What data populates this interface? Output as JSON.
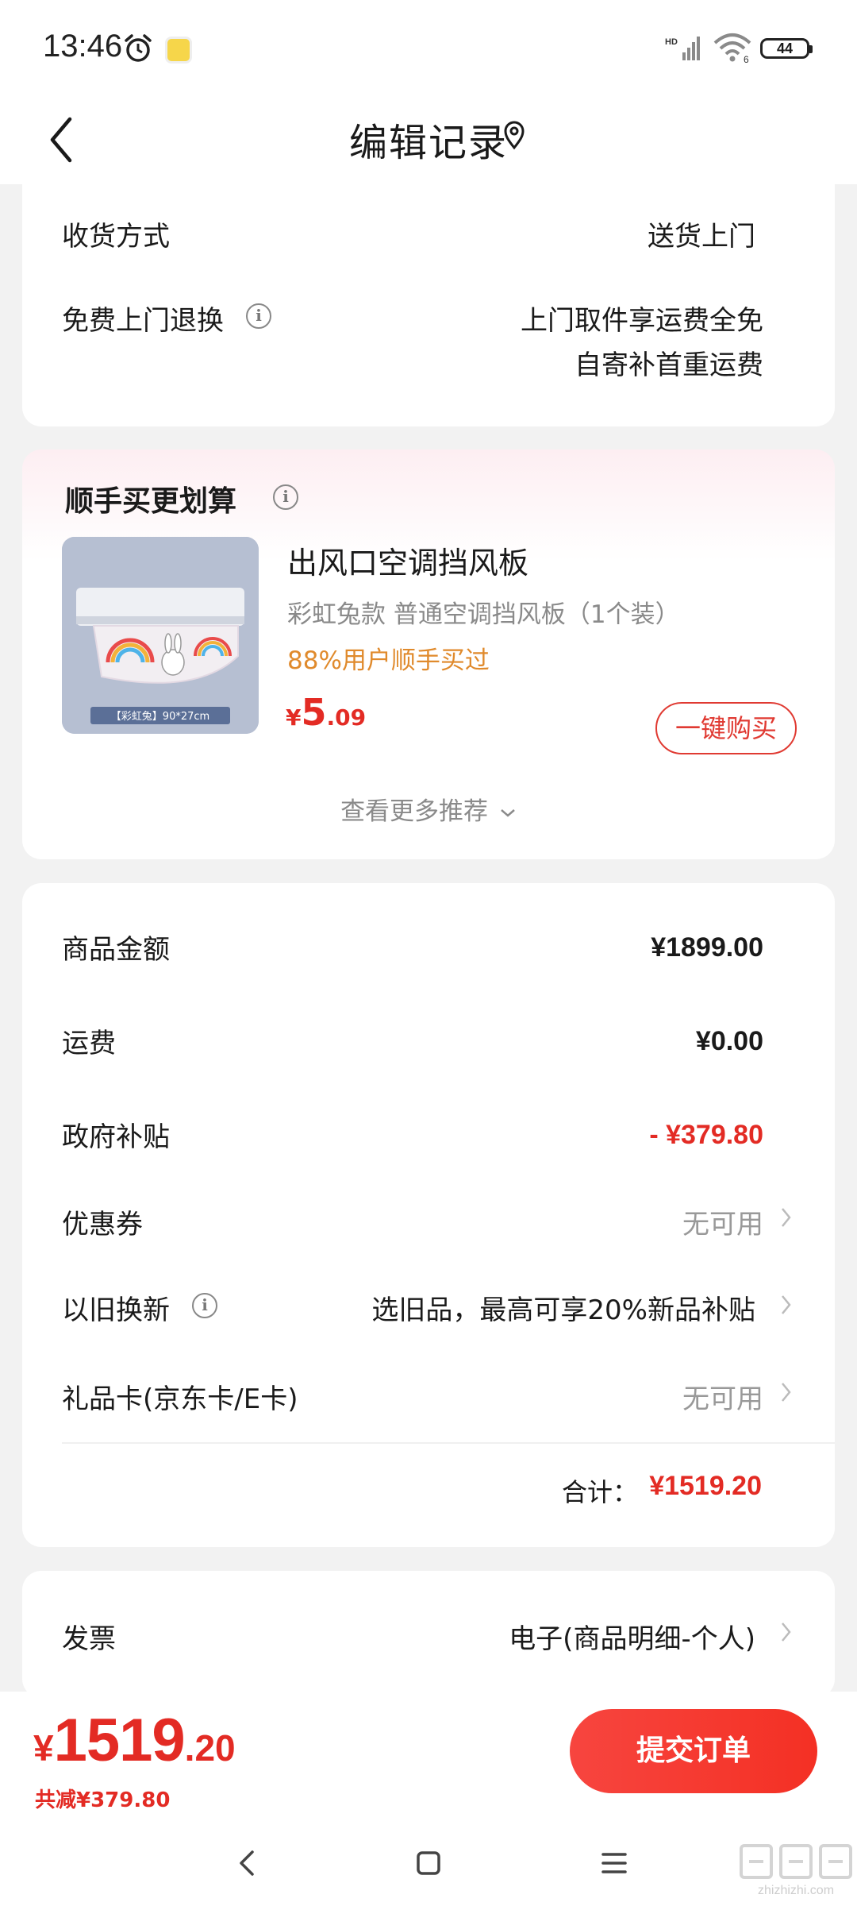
{
  "status_bar": {
    "time": "13:46",
    "network": "HD",
    "wifi_label": "6",
    "battery": "44"
  },
  "header": {
    "title": "编辑记录"
  },
  "delivery": {
    "method_label": "收货方式",
    "method_value": "送货上门",
    "return_label": "免费上门退换",
    "return_value_line1": "上门取件享运费全免",
    "return_value_line2": "自寄补首重运费"
  },
  "recommend": {
    "title": "顺手买更划算",
    "product_name": "出风口空调挡风板",
    "product_variant": "彩虹兔款   普通空调挡风板（1个装）",
    "product_stat": "88%用户顺手买过",
    "price_currency": "¥",
    "price_int": "5",
    "price_dec": ".09",
    "image_caption": "【彩虹兔】90*27cm",
    "buy_label": "一键购买",
    "more_label": "查看更多推荐"
  },
  "price_breakdown": {
    "goods_label": "商品金额",
    "goods_value": "¥1899.00",
    "shipping_label": "运费",
    "shipping_value": "¥0.00",
    "subsidy_label": "政府补贴",
    "subsidy_value": "- ¥379.80",
    "coupon_label": "优惠券",
    "coupon_value": "无可用",
    "tradein_label": "以旧换新",
    "tradein_value": "选旧品，最高可享20%新品补贴",
    "giftcard_label": "礼品卡(京东卡/E卡)",
    "giftcard_value": "无可用",
    "total_label": "合计：",
    "total_value": "¥1519.20"
  },
  "invoice": {
    "label": "发票",
    "value": "电子(商品明细-个人)"
  },
  "bottom_bar": {
    "currency": "¥",
    "total_int": "1519",
    "total_dec": ".20",
    "saved": "共减¥379.80",
    "submit_label": "提交订单"
  },
  "watermark": {
    "text": "zhizhizhi.com"
  },
  "colors": {
    "accent_red": "#e32b24",
    "stat_orange": "#e08a2c",
    "muted_gray": "#8a8a8a"
  }
}
